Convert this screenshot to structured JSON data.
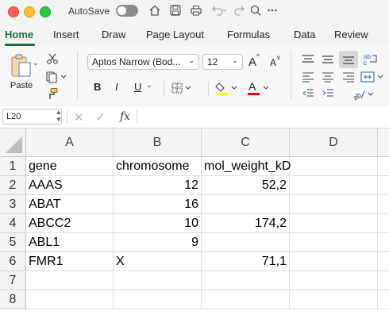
{
  "titlebar": {
    "autosave_label": "AutoSave"
  },
  "tabs": [
    "Home",
    "Insert",
    "Draw",
    "Page Layout",
    "Formulas",
    "Data",
    "Review"
  ],
  "ribbon": {
    "paste_label": "Paste",
    "font_name": "Aptos Narrow (Bod...",
    "font_size": "12",
    "bold": "B",
    "italic": "I",
    "underline": "U",
    "grow_font": "A",
    "shrink_font": "A",
    "font_color": "A",
    "colors": {
      "highlight": "#ffff00",
      "font_color": "#ff0000",
      "accent": "#1d6f42"
    }
  },
  "formula_bar": {
    "name_box": "L20",
    "fx": "fx",
    "formula": ""
  },
  "grid": {
    "columns": [
      "A",
      "B",
      "C",
      "D"
    ],
    "rows": [
      {
        "n": "1",
        "a": "gene",
        "b": "chromosome",
        "c": "mol_weight_kD",
        "d": ""
      },
      {
        "n": "2",
        "a": "AAAS",
        "b": "12",
        "c": "52,2",
        "d": ""
      },
      {
        "n": "3",
        "a": "ABAT",
        "b": "16",
        "c": "",
        "d": ""
      },
      {
        "n": "4",
        "a": "ABCC2",
        "b": "10",
        "c": "174,2",
        "d": ""
      },
      {
        "n": "5",
        "a": "ABL1",
        "b": "9",
        "c": "",
        "d": ""
      },
      {
        "n": "6",
        "a": "FMR1",
        "b": "X",
        "c": "71,1",
        "d": ""
      },
      {
        "n": "7",
        "a": "",
        "b": "",
        "c": "",
        "d": ""
      },
      {
        "n": "8",
        "a": "",
        "b": "",
        "c": "",
        "d": ""
      }
    ]
  }
}
